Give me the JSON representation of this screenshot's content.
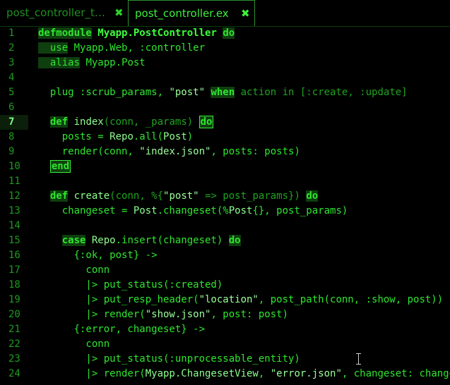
{
  "tabs": [
    {
      "label": "post_controller_t…",
      "close": "✖",
      "active": false
    },
    {
      "label": "post_controller.ex",
      "close": "✖",
      "active": true
    }
  ],
  "editor": {
    "current_line": 7,
    "lines": [
      {
        "n": "1"
      },
      {
        "n": "2"
      },
      {
        "n": "3"
      },
      {
        "n": "4"
      },
      {
        "n": "5"
      },
      {
        "n": "6"
      },
      {
        "n": "7"
      },
      {
        "n": "8"
      },
      {
        "n": "9"
      },
      {
        "n": "10"
      },
      {
        "n": "11"
      },
      {
        "n": "12"
      },
      {
        "n": "13"
      },
      {
        "n": "14"
      },
      {
        "n": "15"
      },
      {
        "n": "16"
      },
      {
        "n": "17"
      },
      {
        "n": "18"
      },
      {
        "n": "19"
      },
      {
        "n": "20"
      },
      {
        "n": "21"
      },
      {
        "n": "22"
      },
      {
        "n": "23"
      },
      {
        "n": "24"
      }
    ],
    "tokens": {
      "l1": [
        "defmodule",
        " ",
        "Myapp.PostController",
        " ",
        "do"
      ],
      "l2": [
        "  use",
        " Myapp.Web, :controller"
      ],
      "l3": [
        "  alias",
        " Myapp.Post"
      ],
      "l5": [
        "  plug :scrub_params, ",
        "\"post\"",
        " ",
        "when",
        " action ",
        "in",
        " [:create, :update]"
      ],
      "l7": [
        "  ",
        "def",
        " ",
        "index",
        "(conn, _params) ",
        "do"
      ],
      "l8": [
        "    posts = ",
        "Repo",
        ".all(",
        "Post",
        ")"
      ],
      "l9": [
        "    render(conn, ",
        "\"index.json\"",
        ", posts: posts)"
      ],
      "l10": [
        "  ",
        "end"
      ],
      "l12": [
        "  ",
        "def",
        " ",
        "create",
        "(conn, %{",
        "\"post\"",
        " => post_params}) ",
        "do"
      ],
      "l13": [
        "    changeset = ",
        "Post",
        ".changeset(%",
        "Post",
        "{}, post_params)"
      ],
      "l15": [
        "    ",
        "case",
        " ",
        "Repo",
        ".insert(changeset) ",
        "do"
      ],
      "l16": [
        "      {:ok, post} ->"
      ],
      "l17": [
        "        conn"
      ],
      "l18": [
        "        |> put_status(:created)"
      ],
      "l19": [
        "        |> put_resp_header(",
        "\"location\"",
        ", post_path(conn, :show, post))"
      ],
      "l20": [
        "        |> render(",
        "\"show.json\"",
        ", post: post)"
      ],
      "l21": [
        "      {:error, changeset} ->"
      ],
      "l22": [
        "        conn"
      ],
      "l23": [
        "        |> put_status(:unprocessable_entity)"
      ],
      "l24": [
        "        |> render(",
        "Myapp.ChangesetView",
        ", ",
        "\"error.json\"",
        ", changeset: changeset)"
      ]
    }
  },
  "colors": {
    "background": "#000000",
    "text": "#2ee62e",
    "keyword_bg": "#0f3e0f",
    "line_number": "#1e9a1e"
  }
}
